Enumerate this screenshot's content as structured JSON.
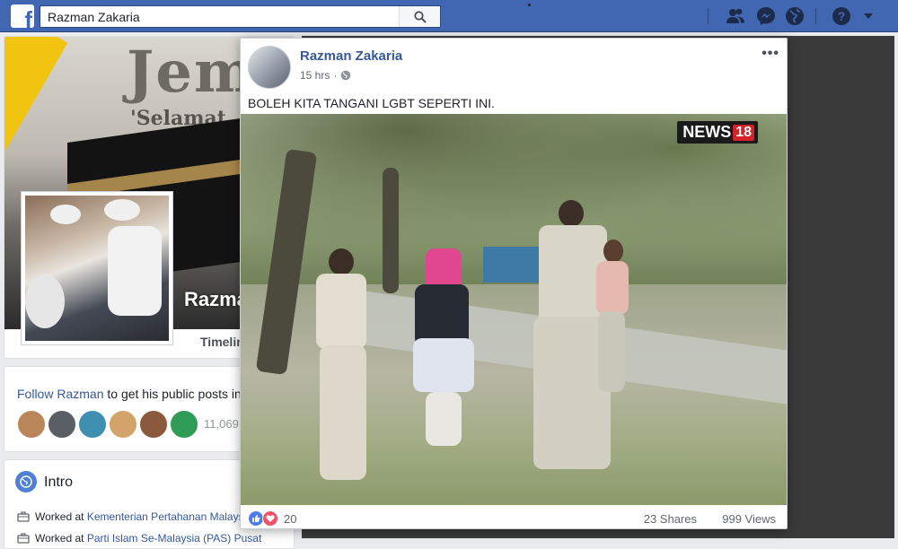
{
  "colors": {
    "brand": "#4267b2",
    "link": "#385898",
    "like": "#4b7bec",
    "love": "#f0526a",
    "news_red": "#d6202a"
  },
  "topbar": {
    "logo_letter": "f",
    "search_value": "Razman Zakaria",
    "icons": [
      "facebook-logo-icon",
      "search-icon",
      "friend-requests-icon",
      "messenger-icon",
      "notifications-globe-icon",
      "help-icon",
      "dropdown-arrow-icon"
    ]
  },
  "profile": {
    "cover_title": "Jem",
    "cover_subtitle": "'Selamat",
    "name": "Razma",
    "timeline_tab": "Timelin"
  },
  "follow": {
    "link": "Follow Razman",
    "text": " to get his public posts in",
    "count": "11,069"
  },
  "intro": {
    "title": "Intro",
    "items": [
      {
        "prefix": "Worked at ",
        "link": "Kementerian Pertahanan Malays"
      },
      {
        "prefix": "Worked at ",
        "link": "Parti Islam Se-Malaysia (PAS) Pusat"
      }
    ]
  },
  "post": {
    "author": "Razman Zakaria",
    "time": "15 hrs",
    "privacy_icon": "public-globe-icon",
    "menu_label": "•••",
    "text": "BOLEH KITA TANGANI LGBT SEPERTI INI.",
    "video": {
      "watermark": "NEWS",
      "watermark_num": "18"
    },
    "reactions": {
      "count": "20",
      "types": [
        "like",
        "love"
      ]
    },
    "shares": "23 Shares",
    "views": "999 Views"
  }
}
